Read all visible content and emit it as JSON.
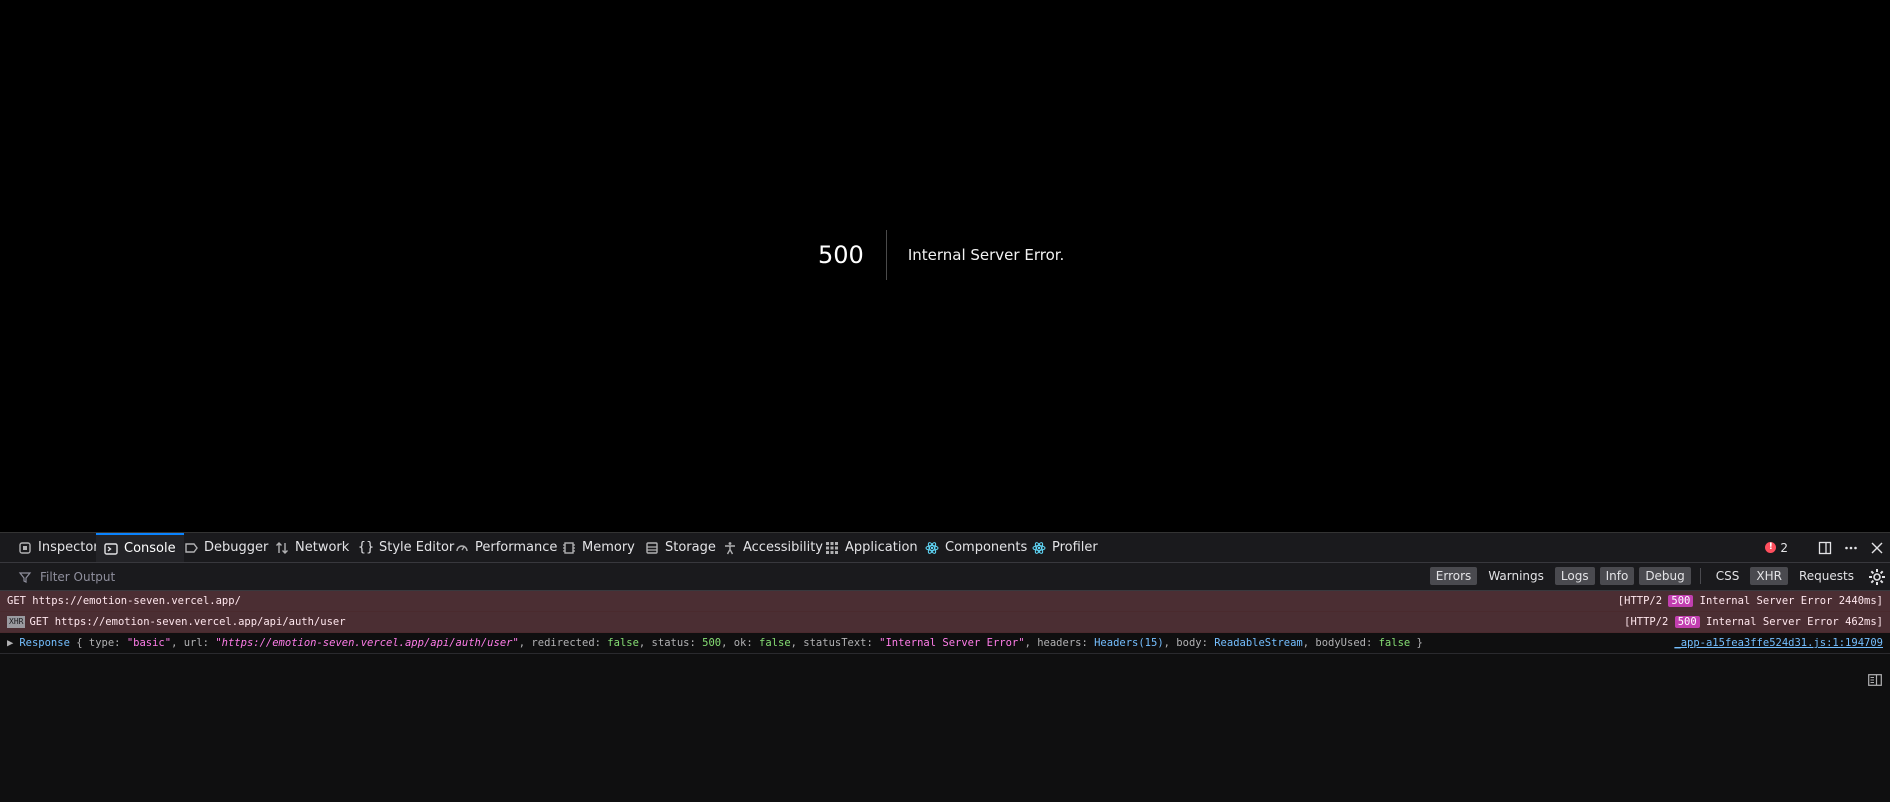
{
  "page": {
    "error_code": "500",
    "error_message": "Internal Server Error."
  },
  "devtools": {
    "tabs": [
      {
        "label": "Inspector",
        "icon": "inspector-icon"
      },
      {
        "label": "Console",
        "icon": "console-icon",
        "active": true
      },
      {
        "label": "Debugger",
        "icon": "debugger-icon"
      },
      {
        "label": "Network",
        "icon": "network-icon"
      },
      {
        "label": "Style Editor",
        "icon": "style-editor-icon"
      },
      {
        "label": "Performance",
        "icon": "performance-icon"
      },
      {
        "label": "Memory",
        "icon": "memory-icon"
      },
      {
        "label": "Storage",
        "icon": "storage-icon"
      },
      {
        "label": "Accessibility",
        "icon": "accessibility-icon"
      },
      {
        "label": "Application",
        "icon": "application-icon"
      },
      {
        "label": "Components",
        "icon": "react-icon"
      },
      {
        "label": "Profiler",
        "icon": "react-icon"
      }
    ],
    "error_count": "2",
    "filter": {
      "placeholder": "Filter Output",
      "chips": [
        {
          "label": "Errors",
          "on": true
        },
        {
          "label": "Warnings",
          "on": false
        },
        {
          "label": "Logs",
          "on": true
        },
        {
          "label": "Info",
          "on": true
        },
        {
          "label": "Debug",
          "on": true
        },
        {
          "label": "CSS",
          "on": false
        },
        {
          "label": "XHR",
          "on": true
        },
        {
          "label": "Requests",
          "on": false
        }
      ]
    },
    "logs": [
      {
        "type": "error",
        "text": "GET https://emotion-seven.vercel.app/",
        "info_prefix": "[HTTP/2 ",
        "status": "500",
        "info_suffix": " Internal Server Error 2440ms]"
      },
      {
        "type": "error",
        "xhr_label": "XHR",
        "text": "GET https://emotion-seven.vercel.app/api/auth/user",
        "info_prefix": "[HTTP/2 ",
        "status": "500",
        "info_suffix": " Internal Server Error 462ms]"
      }
    ],
    "response_log": {
      "name": "Response",
      "type_value": "\"basic\"",
      "url_value": "\"https://emotion-seven.vercel.app/api/auth/user\"",
      "redirected": "false",
      "status": "500",
      "ok": "false",
      "status_text": "\"Internal Server Error\"",
      "headers": "Headers(15)",
      "body": "ReadableStream",
      "body_used": "false",
      "source": "_app-a15fea3ffe524d31.js:1:194709"
    }
  }
}
